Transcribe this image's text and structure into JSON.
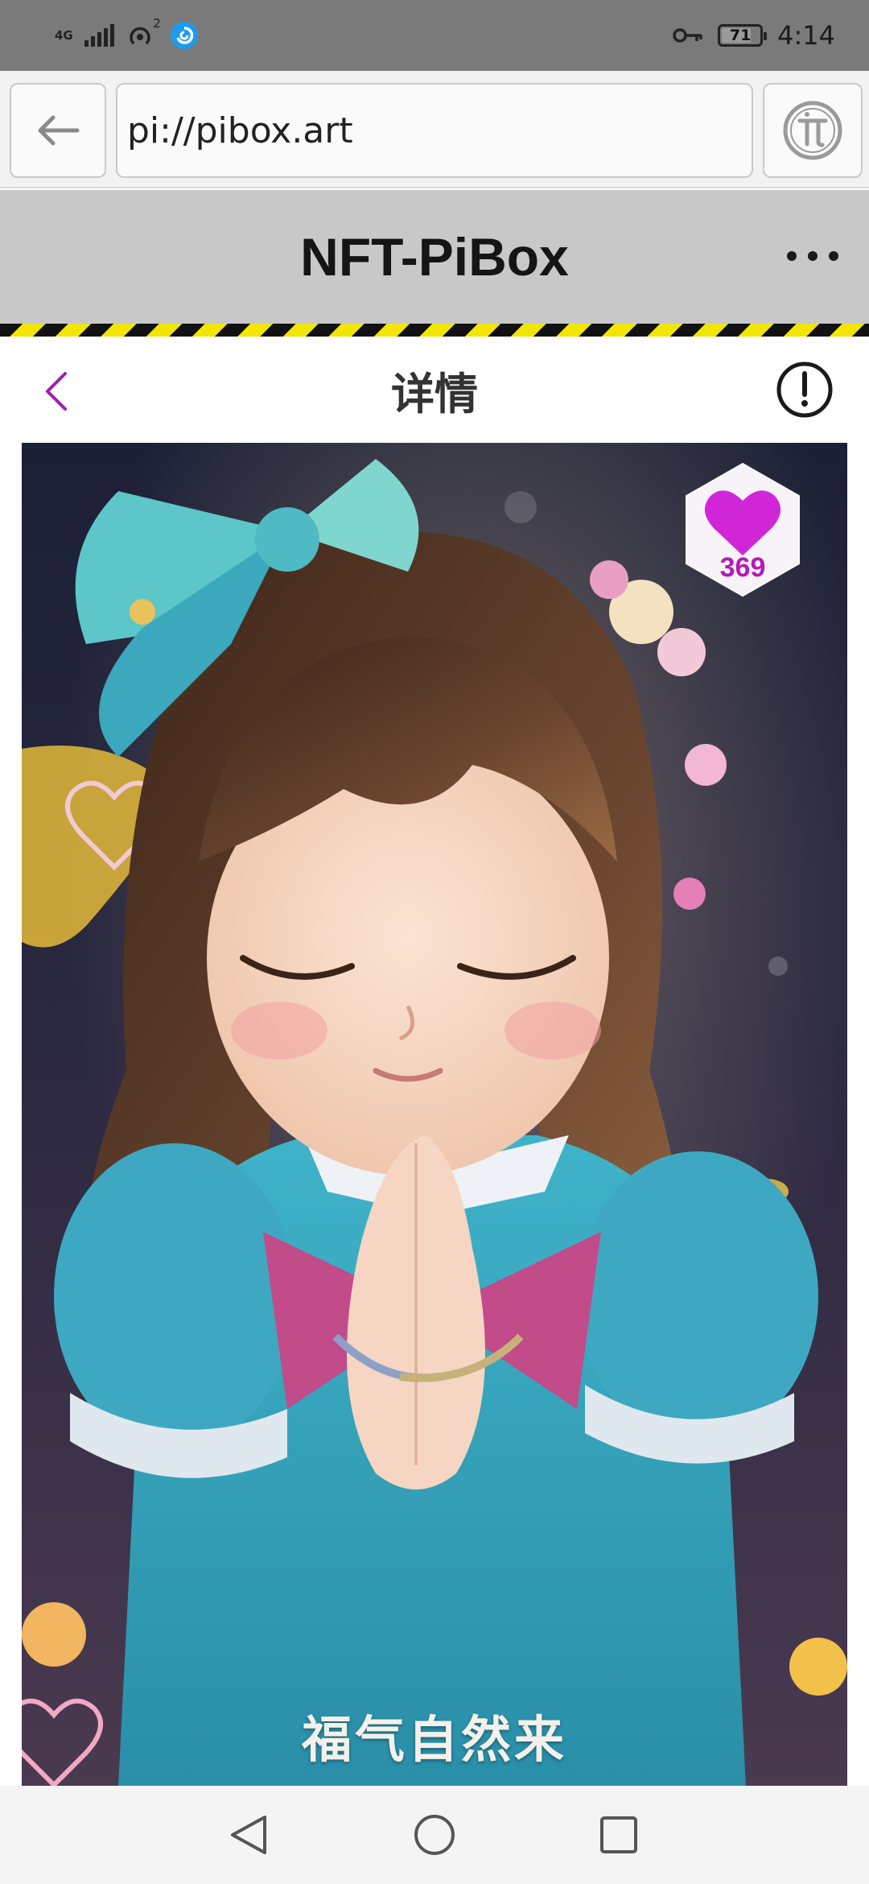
{
  "status_bar": {
    "network_label": "4G",
    "hotspot_count": "2",
    "battery_level": "71",
    "battery_fraction": 0.71,
    "time": "4:14"
  },
  "browser": {
    "url": "pi://pibox.art",
    "back_icon": "arrow-left-icon",
    "pi_icon": "pi-logo-icon"
  },
  "app": {
    "title": "NFT-PiBox",
    "menu_icon": "more-horizontal-icon"
  },
  "detail": {
    "title": "详情",
    "back_icon": "chevron-left-icon",
    "info_icon": "exclamation-circle-icon"
  },
  "artwork": {
    "like_count": "369",
    "like_icon": "heart-icon",
    "caption": "福气自然来"
  },
  "colors": {
    "accent": "#9b1fb5",
    "heart": "#d126d8",
    "stripe_yellow": "#f2e600",
    "stripe_black": "#111111",
    "header_bg": "#c8c8c8"
  },
  "nav": {
    "back_icon": "triangle-back-icon",
    "home_icon": "circle-home-icon",
    "recents_icon": "square-recents-icon"
  }
}
